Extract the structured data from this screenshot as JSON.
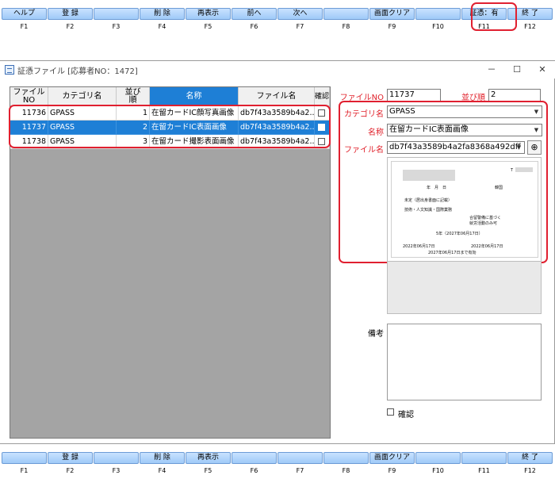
{
  "top_bar": {
    "keys": [
      {
        "label": "ヘルプ",
        "key": "F1"
      },
      {
        "label": "登 録",
        "key": "F2"
      },
      {
        "label": "",
        "key": "F3"
      },
      {
        "label": "削 除",
        "key": "F4"
      },
      {
        "label": "再表示",
        "key": "F5"
      },
      {
        "label": "前へ",
        "key": "F6"
      },
      {
        "label": "次へ",
        "key": "F7"
      },
      {
        "label": "",
        "key": "F8"
      },
      {
        "label": "画面クリア",
        "key": "F9"
      },
      {
        "label": "",
        "key": "F10"
      },
      {
        "label": "証憑：有",
        "key": "F11"
      },
      {
        "label": "終 了",
        "key": "F12"
      }
    ]
  },
  "bottom_bar": {
    "keys": [
      {
        "label": "",
        "key": "F1"
      },
      {
        "label": "登 録",
        "key": "F2"
      },
      {
        "label": "",
        "key": "F3"
      },
      {
        "label": "削 除",
        "key": "F4"
      },
      {
        "label": "再表示",
        "key": "F5"
      },
      {
        "label": "",
        "key": "F6"
      },
      {
        "label": "",
        "key": "F7"
      },
      {
        "label": "",
        "key": "F8"
      },
      {
        "label": "画面クリア",
        "key": "F9"
      },
      {
        "label": "",
        "key": "F10"
      },
      {
        "label": "",
        "key": "F11"
      },
      {
        "label": "終 了",
        "key": "F12"
      }
    ]
  },
  "window": {
    "title": "証憑ファイル [応募者NO：1472]",
    "minimize": "－",
    "maximize": "☐",
    "close": "✕"
  },
  "grid": {
    "headers": {
      "file_no_1": "ファイル",
      "file_no_2": "NO",
      "category": "カテゴリ名",
      "order_1": "並び",
      "order_2": "順",
      "name": "名称",
      "filename": "ファイル名",
      "confirm": "確認"
    },
    "rows": [
      {
        "file_no": "11736",
        "category": "GPASS",
        "order": "1",
        "name": "在留カードIC顔写真画像",
        "filename": "db7f43a3589b4a2...",
        "confirmed": false
      },
      {
        "file_no": "11737",
        "category": "GPASS",
        "order": "2",
        "name": "在留カードIC表面画像",
        "filename": "db7f43a3589b4a2...",
        "confirmed": false
      },
      {
        "file_no": "11738",
        "category": "GPASS",
        "order": "3",
        "name": "在留カード撮影表面画像",
        "filename": "db7f43a3589b4a2...",
        "confirmed": false
      }
    ]
  },
  "detail": {
    "file_no_label": "ファイルNO",
    "file_no": "11737",
    "order_label": "並び順",
    "order": "2",
    "category_label": "カテゴリ名",
    "category": "GPASS",
    "name_label": "名称",
    "name": "在留カードIC表面画像",
    "filename_label": "ファイル名",
    "filename": "db7f43a3589b4a2fa8368a492dff",
    "zoom_icon": "⊕",
    "remarks_label": "備考",
    "confirm_label": "確認"
  },
  "preview_doc": {
    "line1": "T",
    "line2": "年　月　日",
    "line3": "韓国",
    "line4": "未定（居出身書面に記載）",
    "line5": "技術・人文知識・国際業務",
    "line6": "合留警備に基づく",
    "line7": "就労活動のみ可",
    "line8": "5年（2027年06月17日）",
    "line9": "2022年06月17日",
    "line10": "2022年06月17日",
    "line11": "2027年06月17日まで有効"
  },
  "colors": {
    "accent": "#1e7fd6",
    "highlight": "#e02030",
    "required_label": "#e0202a",
    "fkey": "#b6d7fb"
  }
}
